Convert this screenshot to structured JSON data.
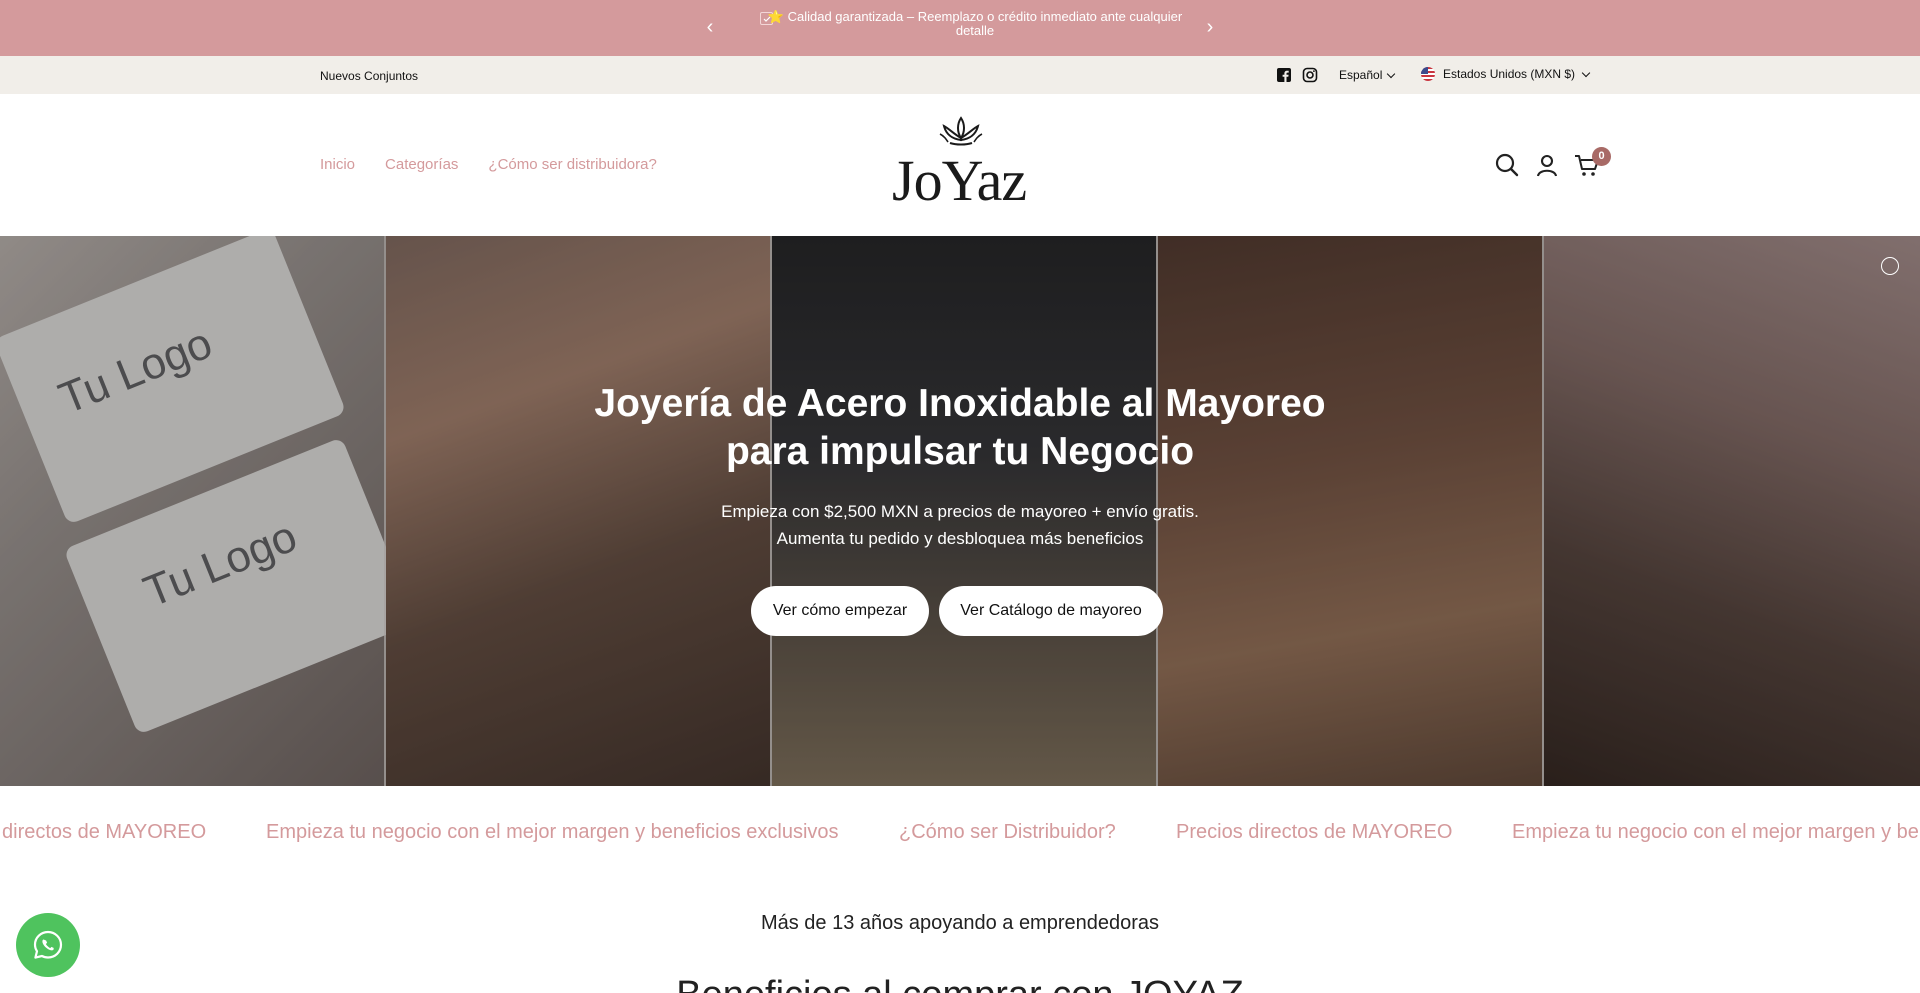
{
  "announcement": {
    "prev_icon": "chevron-left-icon",
    "next_icon": "chevron-right-icon",
    "checkbox_icon": "check-square-icon",
    "message": "⭐ Calidad garantizada – Reemplazo o crédito inmediato ante cualquier detalle",
    "bg_color": "#d49a9c"
  },
  "utility": {
    "left_link": "Nuevos Conjuntos",
    "social": [
      "facebook-icon",
      "instagram-icon"
    ],
    "language": "Español",
    "country": "Estados Unidos (MXN $)"
  },
  "header": {
    "nav": [
      "Inicio",
      "Categorías",
      "¿Cómo ser distribuidora?"
    ],
    "logo_text": "JoYaz",
    "icons": [
      "search-icon",
      "account-icon",
      "cart-icon"
    ],
    "cart_count": "0",
    "accent_color": "#d49a9c"
  },
  "hero": {
    "title_line1": "Joyería de Acero Inoxidable al Mayoreo",
    "title_line2": "para impulsar tu Negocio",
    "subtitle_line1": "Empieza con $2,500 MXN a precios de mayoreo + envío gratis.",
    "subtitle_line2": "Aumenta tu pedido y desbloquea más beneficios",
    "button1": "Ver cómo empezar",
    "button2": "Ver Catálogo de mayoreo",
    "card_text": "Tu Logo"
  },
  "marquee": {
    "items": [
      "directos de MAYOREO",
      "Empieza tu negocio con el mejor margen y beneficios exclusivos",
      "¿Cómo ser Distribuidor?",
      "Precios directos de MAYOREO",
      "Empieza tu negocio con el mejor margen y beneficios exclusivos"
    ]
  },
  "section": {
    "years": "Más de 13 años apoyando a emprendedoras",
    "benefits_title": "Beneficios al comprar con JOYAZ"
  },
  "whatsapp": {
    "icon": "whatsapp-icon",
    "color": "#4fc35e"
  }
}
